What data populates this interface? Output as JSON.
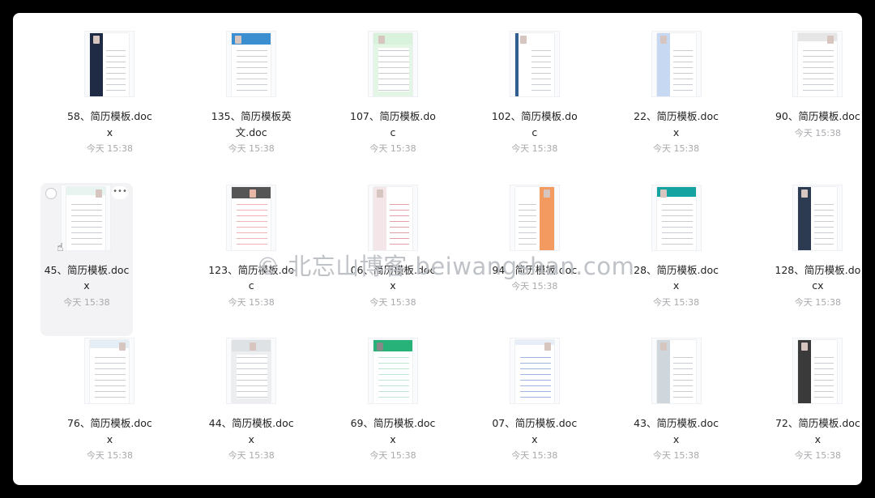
{
  "watermark": "© 北忘山博客 beiwangshan.com",
  "files": [
    {
      "name": "58、简历模板.docx",
      "date": "今天 15:38",
      "style": "side",
      "accent": "#1f2b45"
    },
    {
      "name": "135、简历模板英文.doc",
      "date": "今天 15:38",
      "style": "bar",
      "accent": "#3b8fd0"
    },
    {
      "name": "107、简历模板.doc",
      "date": "今天 15:38",
      "style": "bar",
      "accent": "#d9f2dc"
    },
    {
      "name": "102、简历模板.doc",
      "date": "今天 15:38",
      "style": "side",
      "accent": "#2f5e8f"
    },
    {
      "name": "22、简历模板.docx",
      "date": "今天 15:38",
      "style": "side",
      "accent": "#c6d8f2"
    },
    {
      "name": "90、简历模板.doc",
      "date": "今天 15:38",
      "style": "bar",
      "accent": "#e6e6e6"
    },
    {
      "name": "45、简历模板.docx",
      "date": "今天 15:38",
      "style": "bar",
      "accent": "#e8f4ef"
    },
    {
      "name": "123、简历模板.doc",
      "date": "今天 15:38",
      "style": "bar",
      "accent": "#555555"
    },
    {
      "name": "06、简历模板.docx",
      "date": "今天 15:38",
      "style": "bar",
      "accent": "#f4e6e8"
    },
    {
      "name": "94、简历模板.doc",
      "date": "今天 15:38",
      "style": "side",
      "accent": "#f39a60"
    },
    {
      "name": "28、简历模板.docx",
      "date": "今天 15:38",
      "style": "bar",
      "accent": "#14a3a0"
    },
    {
      "name": "128、简历模板.docx",
      "date": "今天 15:38",
      "style": "side",
      "accent": "#2c3a52"
    },
    {
      "name": "76、简历模板.docx",
      "date": "今天 15:38",
      "style": "bar",
      "accent": "#e5eef5"
    },
    {
      "name": "44、简历模板.docx",
      "date": "今天 15:38",
      "style": "bar",
      "accent": "#dfe2e5"
    },
    {
      "name": "69、简历模板.docx",
      "date": "今天 15:38",
      "style": "bar",
      "accent": "#27b27a"
    },
    {
      "name": "07、简历模板.docx",
      "date": "今天 15:38",
      "style": "bar",
      "accent": "#e8eef8"
    },
    {
      "name": "43、简历模板.docx",
      "date": "今天 15:38",
      "style": "side",
      "accent": "#cfd6dc"
    },
    {
      "name": "72、简历模板.docx",
      "date": "今天 15:38",
      "style": "side",
      "accent": "#3a3a3a"
    }
  ]
}
